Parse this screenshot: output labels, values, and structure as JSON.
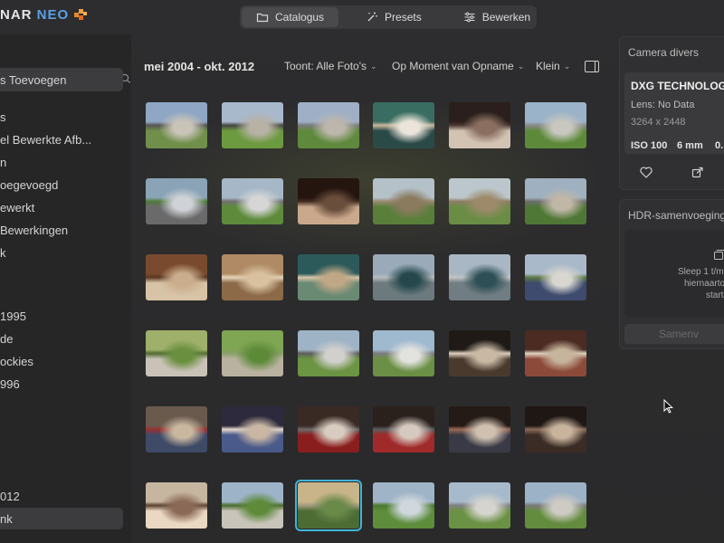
{
  "app": {
    "logo_text": "NAR",
    "logo_neo": "NEO"
  },
  "tabs": [
    {
      "label": "Catalogus",
      "icon": "folder-icon",
      "active": true
    },
    {
      "label": "Presets",
      "icon": "magic-wand-icon",
      "active": false
    },
    {
      "label": "Bewerken",
      "icon": "sliders-icon",
      "active": false
    }
  ],
  "sidebar": {
    "items": [
      {
        "label": "s Toevoegen",
        "selected": true
      },
      {
        "label": "s"
      },
      {
        "label": "el Bewerkte Afb..."
      },
      {
        "label": "n"
      },
      {
        "label": "oegevoegd"
      },
      {
        "label": "ewerkt"
      },
      {
        "label": "Bewerkingen"
      },
      {
        "label": "k"
      },
      {
        "label": "1995"
      },
      {
        "label": "de"
      },
      {
        "label": "ockies"
      },
      {
        "label": "996"
      },
      {
        "label": "012"
      },
      {
        "label": "nk",
        "selected": true
      }
    ]
  },
  "grid_header": {
    "date_range": "mei 2004 - okt. 2012",
    "show_filter": "Toont: Alle Foto's",
    "sort_filter": "Op Moment van Opname",
    "size_filter": "Klein"
  },
  "photos": [
    {
      "scene": "house-yard",
      "colors": [
        "#8fa7c4",
        "#c9c4b8",
        "#6f8f4a",
        "#555"
      ]
    },
    {
      "scene": "house-lawn",
      "colors": [
        "#a8b9cc",
        "#b8b1a5",
        "#6c9a3f",
        "#444"
      ]
    },
    {
      "scene": "house-driveway",
      "colors": [
        "#9fb0c6",
        "#bdb6ac",
        "#5f8a3d",
        "#7a7a7a"
      ]
    },
    {
      "scene": "indoor-person",
      "colors": [
        "#3a6d62",
        "#eae4da",
        "#2a4a48",
        "#c9b89b"
      ]
    },
    {
      "scene": "people-table",
      "colors": [
        "#2a1f1c",
        "#8a6f60",
        "#d3c3b3",
        "#4e3a33"
      ]
    },
    {
      "scene": "car-street",
      "colors": [
        "#9ab3c9",
        "#c8c7c0",
        "#5d8a3a",
        "#8a8a8a"
      ]
    },
    {
      "scene": "car-silver",
      "colors": [
        "#8aa3b6",
        "#cfd2d6",
        "#6a6a6a",
        "#4f7a3a"
      ]
    },
    {
      "scene": "car-white",
      "colors": [
        "#a6b8c8",
        "#d6d6d6",
        "#5e8b3b",
        "#707070"
      ]
    },
    {
      "scene": "people-dinner",
      "colors": [
        "#24150f",
        "#6a4e3c",
        "#c9a88c",
        "#3e2a20"
      ]
    },
    {
      "scene": "yard-woodpile",
      "colors": [
        "#b5c1c9",
        "#8a7a5e",
        "#5a7f3a",
        "#9a8a70"
      ]
    },
    {
      "scene": "yard-woodpile",
      "colors": [
        "#bcc7cd",
        "#9c8a6a",
        "#6a8c45",
        "#8d7d63"
      ]
    },
    {
      "scene": "fence-yard",
      "colors": [
        "#9fb1c0",
        "#c0b7a6",
        "#4f7736",
        "#6d6d6d"
      ]
    },
    {
      "scene": "kitchen",
      "colors": [
        "#7a4a2e",
        "#c9ad8c",
        "#d7c3a5",
        "#5a3622"
      ]
    },
    {
      "scene": "dining-room",
      "colors": [
        "#b08a64",
        "#d9c1a0",
        "#8c6a48",
        "#e6d5bb"
      ]
    },
    {
      "scene": "people-teal",
      "colors": [
        "#2c5a5a",
        "#c0a886",
        "#6a8a74",
        "#d8c7a9"
      ]
    },
    {
      "scene": "car-teal",
      "colors": [
        "#9aaab8",
        "#26484d",
        "#6c7a7e",
        "#b8bcbe"
      ]
    },
    {
      "scene": "car-teal",
      "colors": [
        "#a8b7c3",
        "#2d4f55",
        "#707d82",
        "#c2c4c4"
      ]
    },
    {
      "scene": "house-blue-car",
      "colors": [
        "#a9b9c9",
        "#d8d6d0",
        "#3e4a6e",
        "#5c7a44"
      ]
    },
    {
      "scene": "garden",
      "colors": [
        "#9fb06a",
        "#6a8f3e",
        "#c9c2b6",
        "#4f6a30"
      ]
    },
    {
      "scene": "garden-path",
      "colors": [
        "#7fa653",
        "#5d8a38",
        "#b9b2a0",
        "#89a06a"
      ]
    },
    {
      "scene": "house-porch",
      "colors": [
        "#9eb4c6",
        "#d2d0cc",
        "#6b9443",
        "#5d5d5d"
      ]
    },
    {
      "scene": "house-white",
      "colors": [
        "#9fb9cf",
        "#e2e2de",
        "#6b8f44",
        "#7c7c7c"
      ]
    },
    {
      "scene": "person-dark",
      "colors": [
        "#1f1a16",
        "#c8b8a4",
        "#4a3a2e",
        "#e0d2c0"
      ]
    },
    {
      "scene": "living-room",
      "colors": [
        "#4b2b22",
        "#c7b49c",
        "#8c4a3a",
        "#e2d4c2"
      ]
    },
    {
      "scene": "people-sofa",
      "colors": [
        "#6a5a4e",
        "#c9b7a0",
        "#3e4a66",
        "#9a3030"
      ]
    },
    {
      "scene": "sleeping",
      "colors": [
        "#2d2a3e",
        "#c9b6a3",
        "#4a5a8a",
        "#e6dad0"
      ]
    },
    {
      "scene": "man-white-hair",
      "colors": [
        "#3a2a24",
        "#d8ccc0",
        "#8a1e1e",
        "#6a6a6a"
      ]
    },
    {
      "scene": "man-suit",
      "colors": [
        "#2a201c",
        "#d6cac0",
        "#a02a2a",
        "#5c5c5c"
      ]
    },
    {
      "scene": "couple",
      "colors": [
        "#241a16",
        "#cfc0b0",
        "#3a3a46",
        "#9a6a54"
      ]
    },
    {
      "scene": "group",
      "colors": [
        "#1e1714",
        "#c8b49c",
        "#3c2c26",
        "#8a6a58"
      ]
    },
    {
      "scene": "family",
      "colors": [
        "#c6b6a0",
        "#8a6a56",
        "#ead8c2",
        "#5a4030"
      ]
    },
    {
      "scene": "shed-yard",
      "colors": [
        "#9db4c8",
        "#5e8a3a",
        "#c8c4ba",
        "#4a6a2c"
      ]
    },
    {
      "scene": "field-sunset",
      "colors": [
        "#c9b48a",
        "#6a8a4a",
        "#4d6c34",
        "#a39b82"
      ]
    },
    {
      "scene": "field-sky",
      "colors": [
        "#9fb4c6",
        "#d0d8de",
        "#5e8d3c",
        "#4a7a2e"
      ]
    },
    {
      "scene": "house-street",
      "colors": [
        "#a6bacb",
        "#d6d4ce",
        "#6b9244",
        "#808080"
      ]
    },
    {
      "scene": "house-street",
      "colors": [
        "#9cb2c6",
        "#cecbc4",
        "#648c3f",
        "#7a7a7a"
      ]
    }
  ],
  "right_panel": {
    "camera_title": "Camera divers",
    "camera_make": "DXG TECHNOLOGY",
    "lens": "Lens: No Data",
    "resolution": "3264 x 2448",
    "iso": "ISO 100",
    "focal": "6 mm",
    "aperture": "0.",
    "hdr_title": "HDR-samenvoeging",
    "drop_line1": "Sleep 1 t/m",
    "drop_line2": "hiernaarto",
    "drop_line3": "start",
    "merge_button": "Samenv"
  }
}
